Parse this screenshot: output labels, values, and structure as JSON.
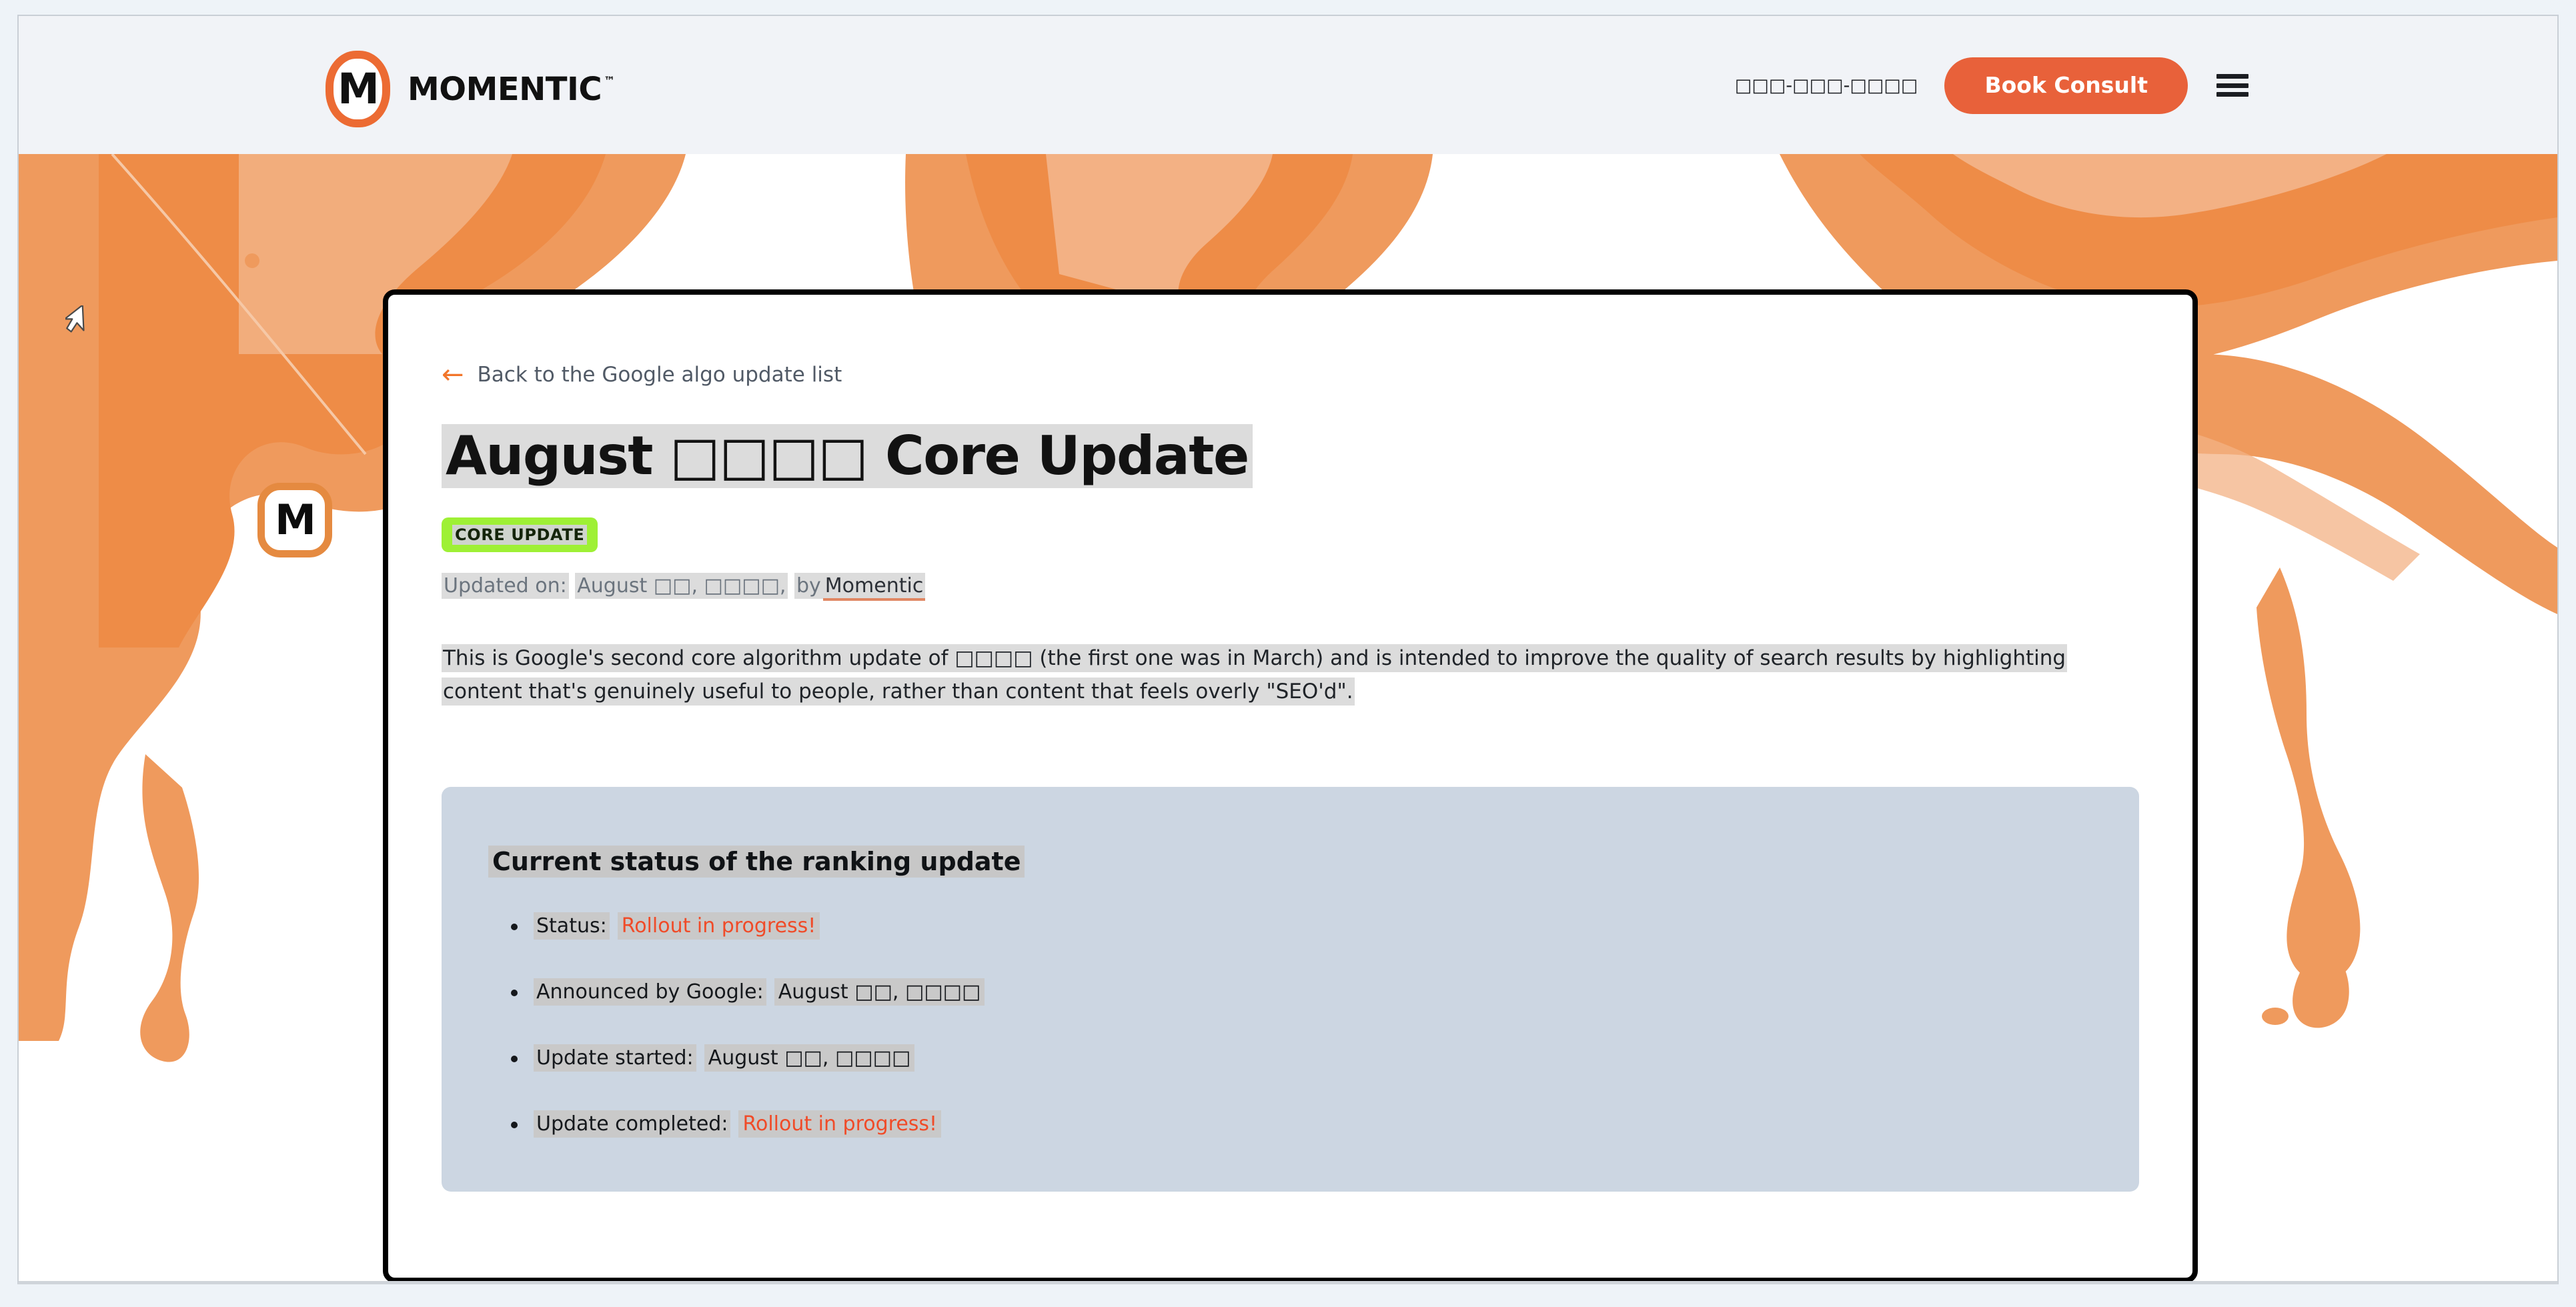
{
  "header": {
    "logo_letter": "M",
    "brand_word": "MOMENTIC",
    "brand_tm": "™",
    "phone": "□□□-□□□-□□□□",
    "book_consult_label": "Book Consult"
  },
  "hero": {
    "watermark_letter": "M"
  },
  "article": {
    "back_link": "Back to the Google algo update list",
    "back_arrow_glyph": "←",
    "title": "August □□□□ Core Update",
    "tag": "CORE UPDATE",
    "byline": {
      "prefix": "Updated on:",
      "date": "August □□, □□□□,",
      "by": "by",
      "author": "Momentic"
    },
    "lede": "This is Google's second core algorithm update of □□□□ (the first one was in March) and is intended to improve the quality of search results by highlighting content that's genuinely useful to people, rather than content that feels overly \"SEO'd\"."
  },
  "status_panel": {
    "heading": "Current status of the ranking update",
    "items": [
      {
        "label": "Status:",
        "value": "Rollout in progress!",
        "alert": true
      },
      {
        "label": "Announced by Google:",
        "value": "August □□, □□□□",
        "alert": false
      },
      {
        "label": "Update started:",
        "value": "August □□, □□□□",
        "alert": false
      },
      {
        "label": "Update completed:",
        "value": "Rollout in progress!",
        "alert": true
      }
    ]
  },
  "colors": {
    "brand_orange": "#e8613a",
    "logo_orange": "#ec6b33",
    "paint_orange": "#ef9a5d",
    "paint_orange_dark": "#ee8c47",
    "badge_green": "#9ef035",
    "panel_blue": "#ccd6e2",
    "alert_red": "#f04b28",
    "selection_gray": "#dcdcdc",
    "header_bg": "#f1f3f7",
    "page_bg": "#eef3f8"
  }
}
